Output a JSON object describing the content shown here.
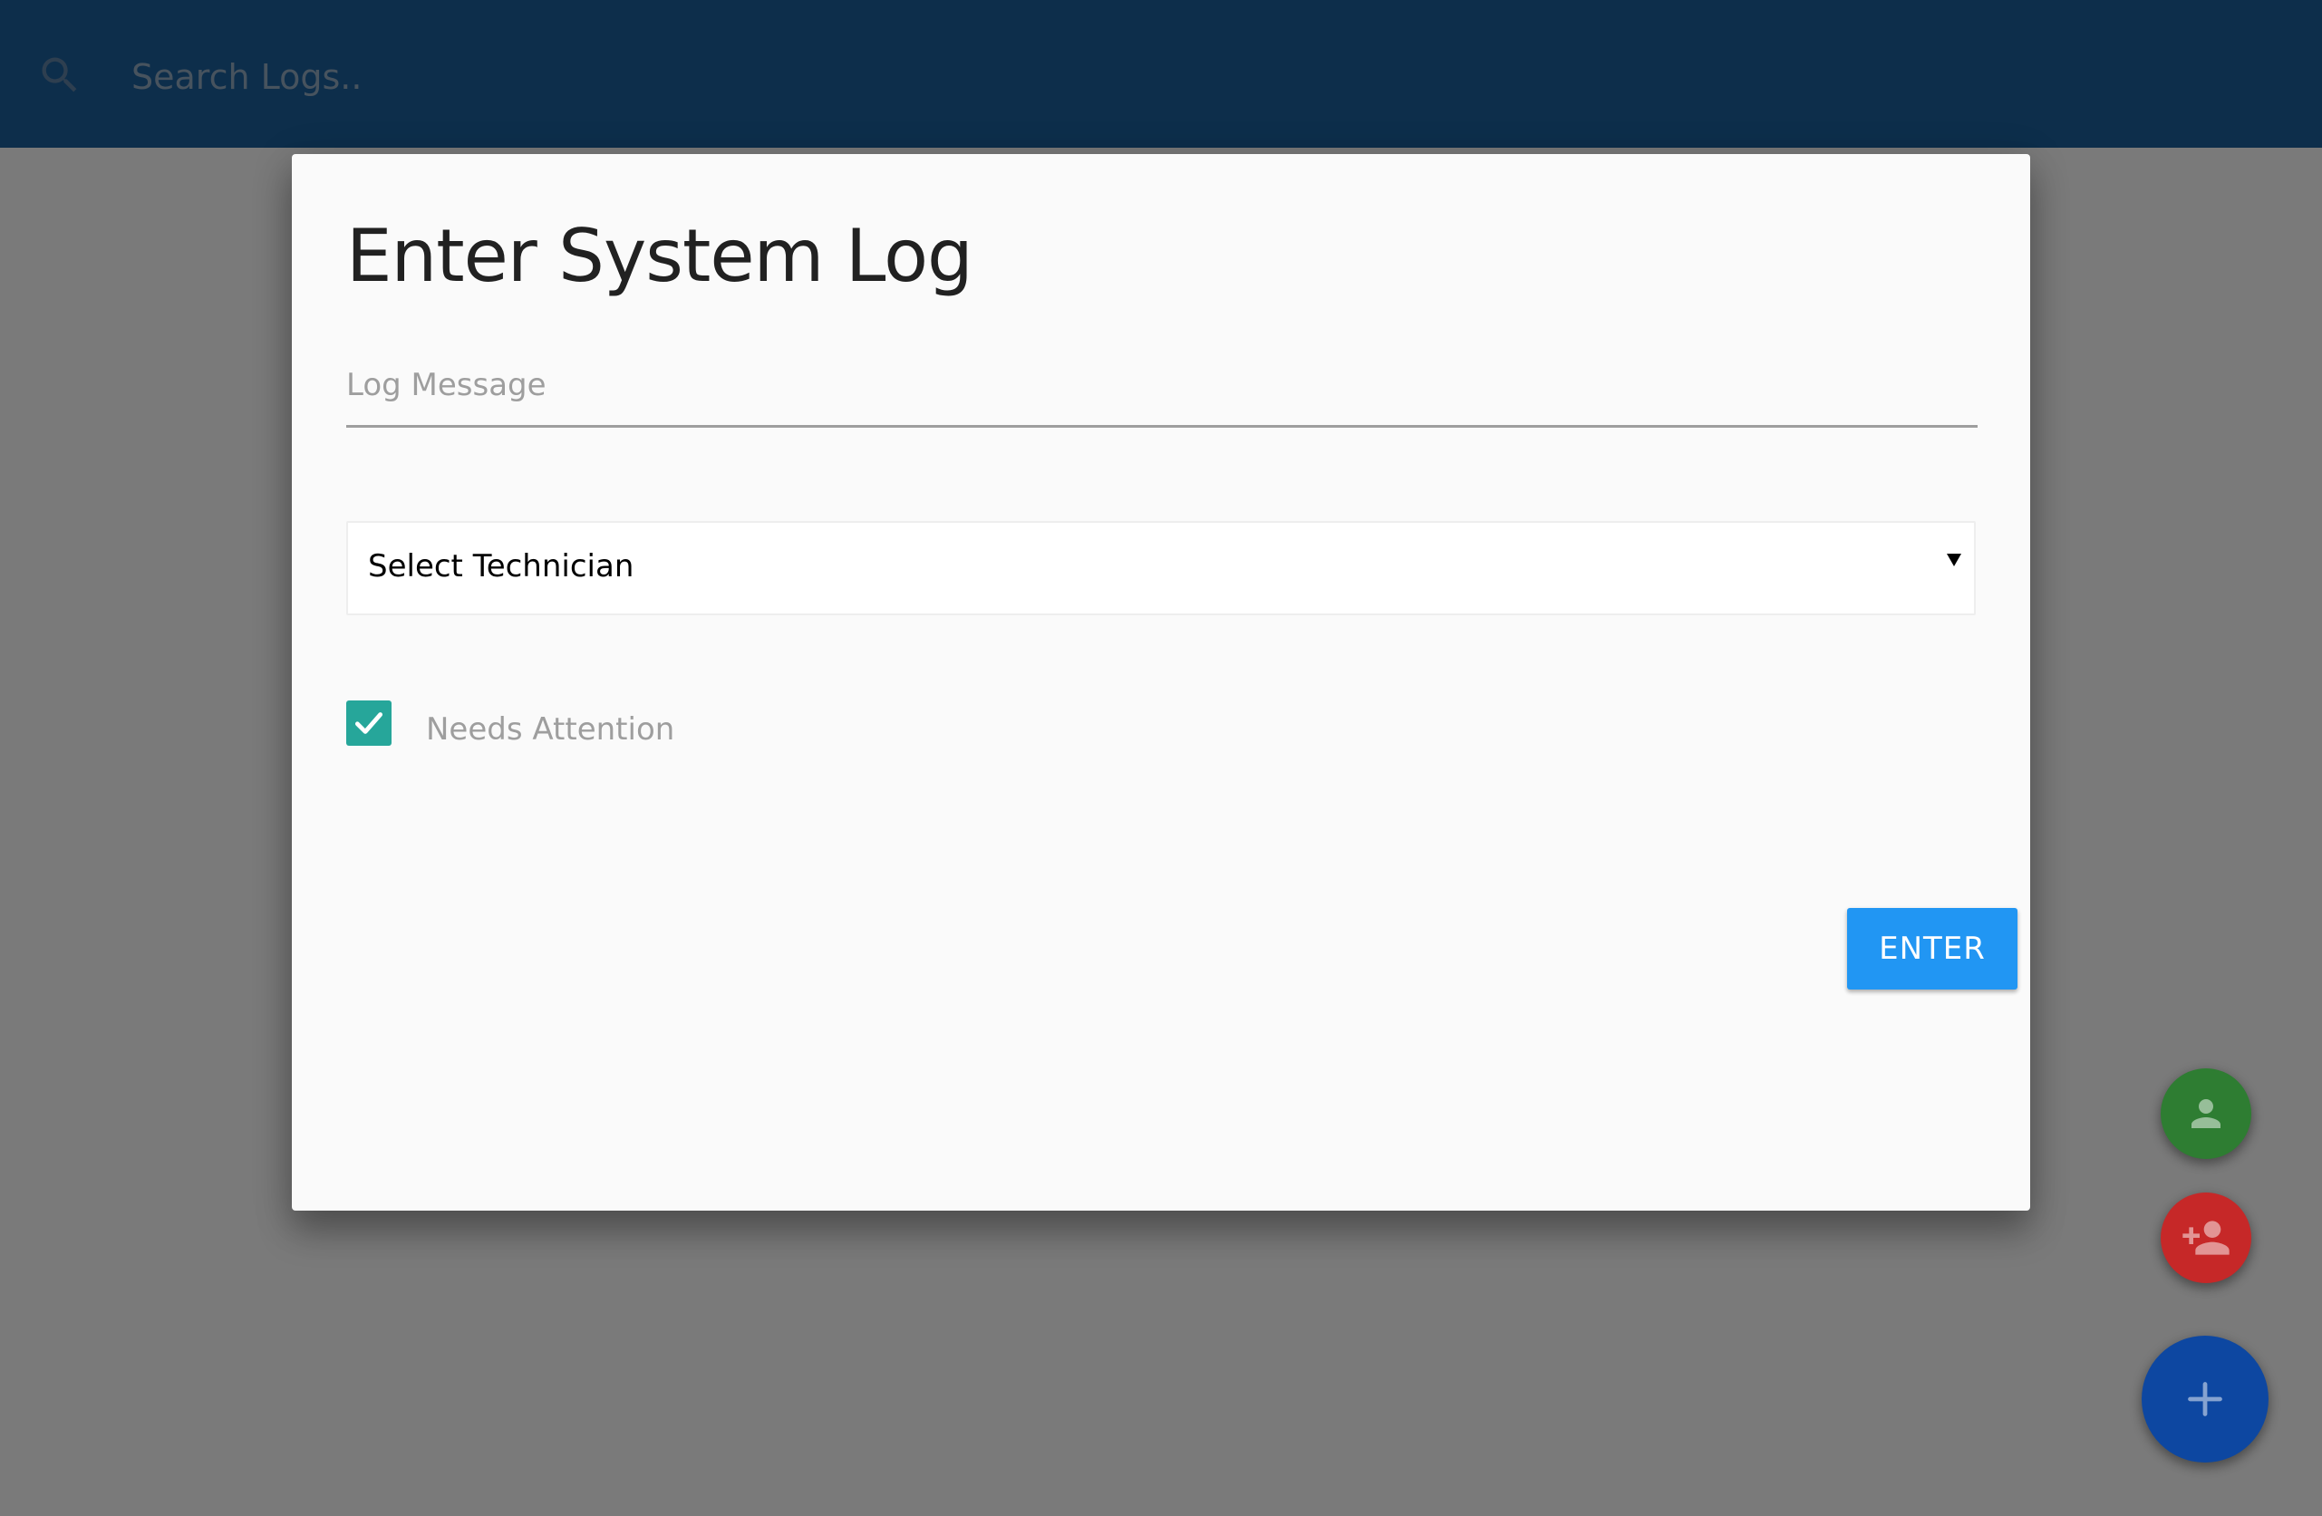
{
  "search": {
    "placeholder": "Search Logs.."
  },
  "modal": {
    "title": "Enter System Log",
    "log_message_placeholder": "Log Message",
    "technician_select": {
      "selected": "Select Technician"
    },
    "needs_attention": {
      "label": "Needs Attention",
      "checked": true
    },
    "enter_label": "ENTER"
  },
  "fabs": [
    {
      "icon": "person-icon",
      "color": "#2e7d32"
    },
    {
      "icon": "person-add-icon",
      "color": "#c62828"
    },
    {
      "icon": "plus-icon",
      "color": "#0d47a1"
    }
  ],
  "colors": {
    "navbar": "#1a5c96",
    "accent": "#2196f3",
    "checkbox": "#26a69a"
  }
}
